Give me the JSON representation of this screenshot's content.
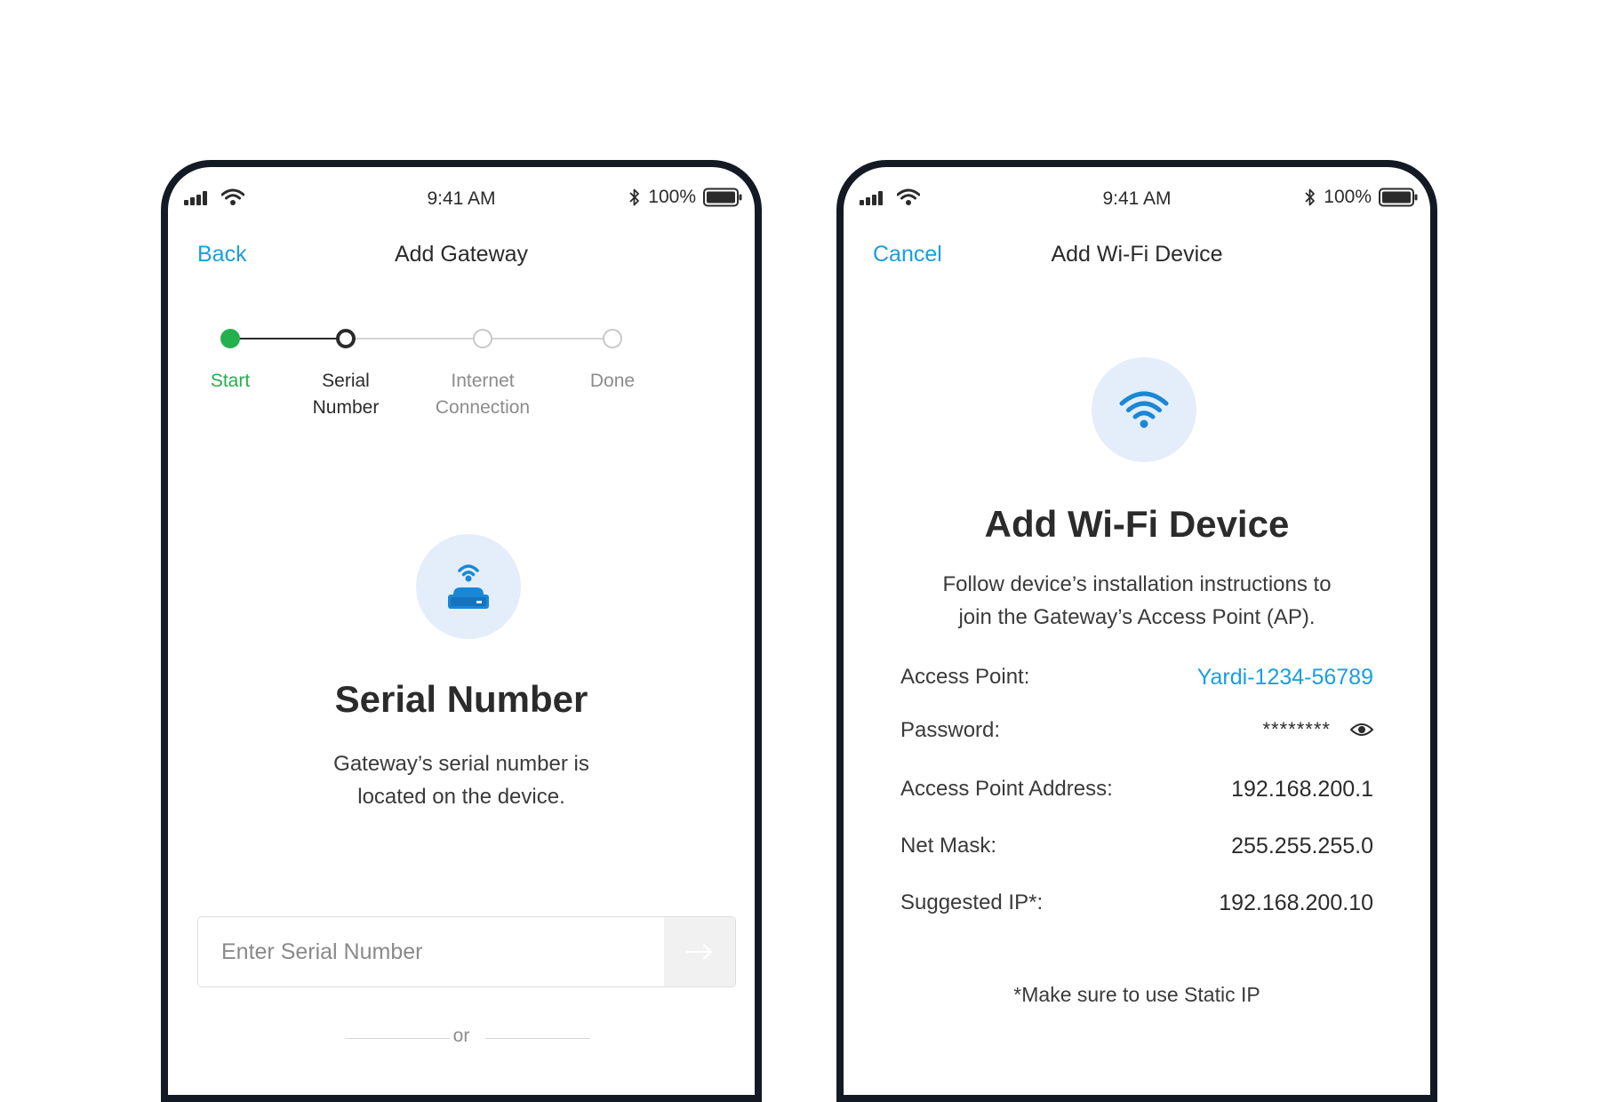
{
  "status_bar": {
    "time": "9:41 AM",
    "battery_percent": "100%",
    "icons": [
      "signal-icon",
      "wifi-icon",
      "bluetooth-icon",
      "battery-icon"
    ]
  },
  "left_screen": {
    "nav": {
      "back_label": "Back",
      "title": "Add Gateway"
    },
    "stepper": {
      "steps": [
        {
          "label_line1": "Start",
          "label_line2": "",
          "state": "completed"
        },
        {
          "label_line1": "Serial",
          "label_line2": "Number",
          "state": "current"
        },
        {
          "label_line1": "Internet",
          "label_line2": "Connection",
          "state": "upcoming"
        },
        {
          "label_line1": "Done",
          "label_line2": "",
          "state": "upcoming"
        }
      ]
    },
    "hero": {
      "icon": "gateway-icon",
      "title": "Serial Number",
      "description_line1": "Gateway’s serial number is",
      "description_line2": "located on the device."
    },
    "serial_input": {
      "placeholder": "Enter Serial Number",
      "value": "",
      "submit_icon": "arrow-right-icon"
    },
    "divider_text": "or"
  },
  "right_screen": {
    "nav": {
      "cancel_label": "Cancel",
      "title": "Add Wi-Fi Device"
    },
    "hero": {
      "icon": "wifi-icon",
      "title": "Add Wi-Fi Device",
      "description_line1": "Follow device’s installation instructions to",
      "description_line2": "join the Gateway’s Access Point (AP)."
    },
    "details": {
      "access_point_label": "Access Point:",
      "access_point_value": "Yardi-1234-56789",
      "password_label": "Password:",
      "password_value": "********",
      "password_toggle_icon": "eye-icon",
      "ap_address_label": "Access Point Address:",
      "ap_address_value": "192.168.200.1",
      "net_mask_label": "Net Mask:",
      "net_mask_value": "255.255.255.0",
      "suggested_ip_label": "Suggested IP*:",
      "suggested_ip_value": "192.168.200.10"
    },
    "footnote": "*Make sure to use Static IP"
  },
  "colors": {
    "accent_blue": "#1a9ee0",
    "step_complete_green": "#22b14c",
    "step_current": "#2b2b2b",
    "step_upcoming": "#c8c8c8",
    "hero_circle_bg": "#e4eefa",
    "phone_frame": "#141a24"
  }
}
